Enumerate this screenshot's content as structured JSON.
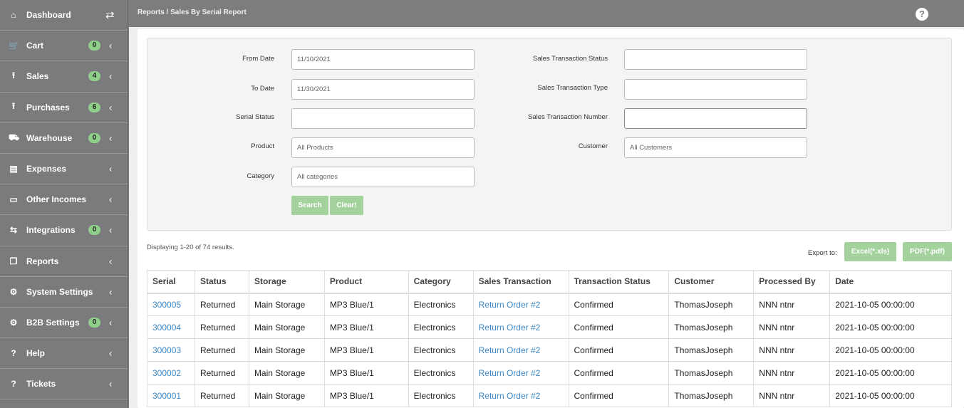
{
  "sidebar": {
    "items": [
      {
        "label": "Dashboard",
        "icon": "home-icon",
        "glyph": "⌂"
      },
      {
        "label": "Cart",
        "icon": "cart-icon",
        "glyph": "🛒",
        "badge": "0"
      },
      {
        "label": "Sales",
        "icon": "upload-icon",
        "glyph": "⭱",
        "badge": "4"
      },
      {
        "label": "Purchases",
        "icon": "upload-icon",
        "glyph": "⭱",
        "badge": "6"
      },
      {
        "label": "Warehouse",
        "icon": "truck-icon",
        "glyph": "⛟",
        "badge": "0"
      },
      {
        "label": "Expenses",
        "icon": "file-icon",
        "glyph": "▤"
      },
      {
        "label": "Other Incomes",
        "icon": "money-icon",
        "glyph": "▭"
      },
      {
        "label": "Integrations",
        "icon": "integrations-icon",
        "glyph": "⇆",
        "badge": "0"
      },
      {
        "label": "Reports",
        "icon": "copy-icon",
        "glyph": "❐"
      },
      {
        "label": "System Settings",
        "icon": "gears-icon",
        "glyph": "⚙"
      },
      {
        "label": "B2B Settings",
        "icon": "gears-icon",
        "glyph": "⚙",
        "badge": "0"
      },
      {
        "label": "Help",
        "icon": "question-icon",
        "glyph": "?"
      },
      {
        "label": "Tickets",
        "icon": "question-icon",
        "glyph": "?"
      }
    ]
  },
  "header": {
    "crumb": "Reports /  Sales By Serial Report",
    "help": "?"
  },
  "filters": {
    "from_date_label": "From Date",
    "from_date": "11/10/2021",
    "to_date_label": "To Date",
    "to_date": "11/30/2021",
    "serial_status_label": "Serial Status",
    "serial_status": "",
    "product_label": "Product",
    "product": "All Products",
    "category_label": "Category",
    "category": "All categories",
    "sts_label": "Sales Transaction Status",
    "sts": "",
    "stt_label": "Sales Transaction Type",
    "stt": "",
    "stn_label": "Sales Transaction Number",
    "stn": "",
    "customer_label": "Customer",
    "customer": "All Customers",
    "search": "Search",
    "clear": "Clear!"
  },
  "results": {
    "summary": "Displaying 1-20 of 74 results.",
    "export_label": "Export to:",
    "excel": "Excel(*.xls)",
    "pdf": "PDF(*.pdf)"
  },
  "table": {
    "headers": [
      "Serial",
      "Status",
      "Storage",
      "Product",
      "Category",
      "Sales Transaction",
      "Transaction Status",
      "Customer",
      "Processed By",
      "Date"
    ],
    "rows": [
      [
        "300005",
        "Returned",
        "Main Storage",
        "MP3 Blue/1",
        "Electronics",
        "Return Order #2",
        "Confirmed",
        "ThomasJoseph",
        "NNN ntnr",
        "2021-10-05 00:00:00"
      ],
      [
        "300004",
        "Returned",
        "Main Storage",
        "MP3 Blue/1",
        "Electronics",
        "Return Order #2",
        "Confirmed",
        "ThomasJoseph",
        "NNN ntnr",
        "2021-10-05 00:00:00"
      ],
      [
        "300003",
        "Returned",
        "Main Storage",
        "MP3 Blue/1",
        "Electronics",
        "Return Order #2",
        "Confirmed",
        "ThomasJoseph",
        "NNN ntnr",
        "2021-10-05 00:00:00"
      ],
      [
        "300002",
        "Returned",
        "Main Storage",
        "MP3 Blue/1",
        "Electronics",
        "Return Order #2",
        "Confirmed",
        "ThomasJoseph",
        "NNN ntnr",
        "2021-10-05 00:00:00"
      ],
      [
        "300001",
        "Returned",
        "Main Storage",
        "MP3 Blue/1",
        "Electronics",
        "Return Order #2",
        "Confirmed",
        "ThomasJoseph",
        "NNN ntnr",
        "2021-10-05 00:00:00"
      ]
    ]
  }
}
